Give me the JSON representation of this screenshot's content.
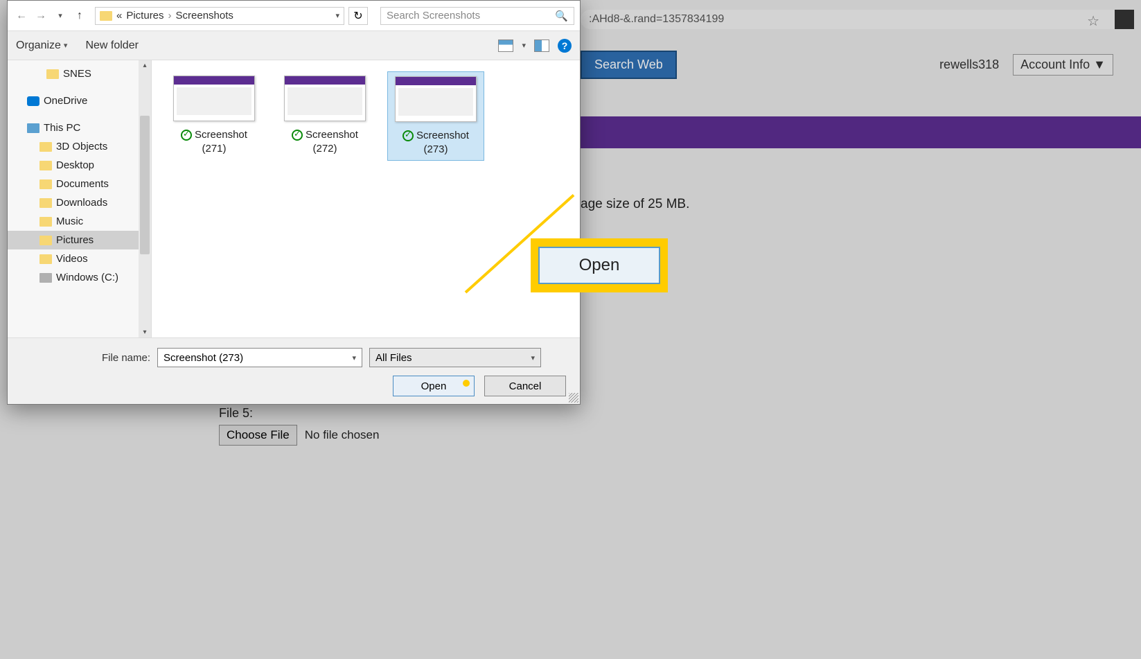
{
  "browser": {
    "url_fragment": ":AHd8-&.rand=1357834199",
    "search_web": "Search Web",
    "username": "rewells318",
    "account_info": "Account Info  ▼"
  },
  "page": {
    "size_text": "age size of 25 MB.",
    "file5_label": "File 5:",
    "choose_file": "Choose File",
    "no_file": "No file chosen"
  },
  "dialog": {
    "breadcrumb": {
      "prefix": "«",
      "p1": "Pictures",
      "p2": "Screenshots"
    },
    "search_placeholder": "Search Screenshots",
    "toolbar": {
      "organize": "Organize",
      "new_folder": "New folder"
    },
    "tree": [
      {
        "label": "SNES",
        "level": 2,
        "icon": "folder"
      },
      {
        "label": "OneDrive",
        "level": 0,
        "icon": "onedrive"
      },
      {
        "label": "This PC",
        "level": 0,
        "icon": "pc"
      },
      {
        "label": "3D Objects",
        "level": 1,
        "icon": "folder"
      },
      {
        "label": "Desktop",
        "level": 1,
        "icon": "folder"
      },
      {
        "label": "Documents",
        "level": 1,
        "icon": "folder"
      },
      {
        "label": "Downloads",
        "level": 1,
        "icon": "folder"
      },
      {
        "label": "Music",
        "level": 1,
        "icon": "folder"
      },
      {
        "label": "Pictures",
        "level": 1,
        "icon": "folder",
        "selected": true
      },
      {
        "label": "Videos",
        "level": 1,
        "icon": "folder"
      },
      {
        "label": "Windows (C:)",
        "level": 1,
        "icon": "drive"
      }
    ],
    "files": [
      {
        "name": "Screenshot (271)",
        "selected": false
      },
      {
        "name": "Screenshot (272)",
        "selected": false
      },
      {
        "name": "Screenshot (273)",
        "selected": true
      }
    ],
    "file_name_label": "File name:",
    "file_name_value": "Screenshot (273)",
    "filter": "All Files",
    "open": "Open",
    "cancel": "Cancel"
  },
  "callout": {
    "label": "Open"
  }
}
